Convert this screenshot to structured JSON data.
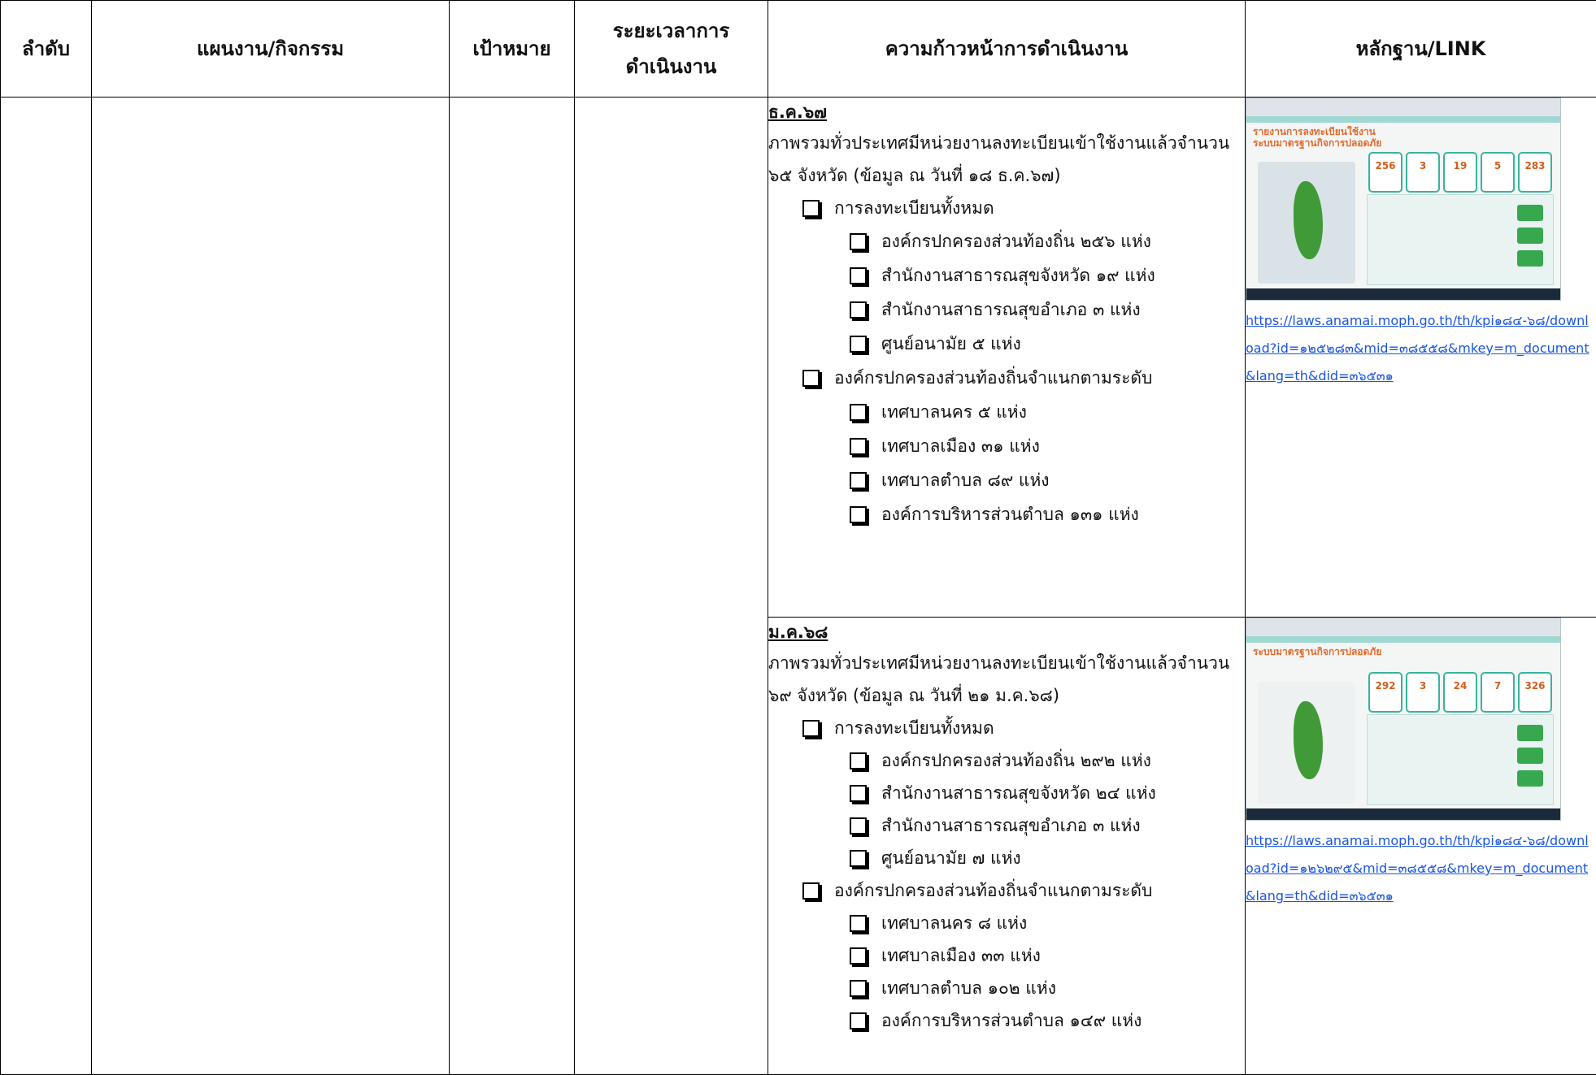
{
  "headers": {
    "order": "ลำดับ",
    "plan": "แผนงาน/กิจกรรม",
    "target": "เป้าหมาย",
    "period": "ระยะเวลาการ ดำเนินงาน",
    "progress": "ความก้าวหน้าการดำเนินงาน",
    "evidence": "หลักฐาน/LINK"
  },
  "rows": [
    {
      "month": "ธ.ค.๖๗",
      "summary": "ภาพรวมทั่วประเทศมีหน่วยงานลงทะเบียนเข้าใช้งานแล้วจำนวน ๖๕ จังหวัด (ข้อมูล ณ วันที่ ๑๘ ธ.ค.๖๗)",
      "group1_title": "การลงทะเบียนทั้งหมด",
      "group1_items": [
        "องค์กรปกครองส่วนท้องถิ่น ๒๕๖ แห่ง",
        "สำนักงานสาธารณสุขจังหวัด ๑๙ แห่ง",
        "สำนักงานสาธารณสุขอำเภอ ๓ แห่ง",
        "ศูนย์อนามัย  ๕ แห่ง"
      ],
      "group2_title": "องค์กรปกครองส่วนท้องถิ่นจำแนกตามระดับ",
      "group2_items": [
        "เทศบาลนคร ๕ แห่ง",
        "เทศบาลเมือง ๓๑ แห่ง",
        "เทศบาลตำบล ๘๙ แห่ง",
        "องค์การบริหารส่วนตำบล ๑๓๑ แห่ง"
      ],
      "screenshot": {
        "banner_line1": "รายงานการลงทะเบียนใช้งาน",
        "banner_line2": "ระบบมาตรฐานกิจการปลอดภัย",
        "tiles": [
          "256",
          "3",
          "19",
          "5",
          "283"
        ]
      },
      "link": "https://laws.anamai.moph.go.th/th/kpi๑๘๔-๖๘/download?id=๑๒๕๒๘๓&mid=๓๘๕๕๘&mkey=m_document&lang=th&did=๓๖๕๓๑"
    },
    {
      "month": "ม.ค.๖๘",
      "summary": "ภาพรวมทั่วประเทศมีหน่วยงานลงทะเบียนเข้าใช้งานแล้วจำนวน ๖๙ จังหวัด (ข้อมูล ณ วันที่ ๒๑ ม.ค.๖๘)",
      "group1_title": "การลงทะเบียนทั้งหมด",
      "group1_items": [
        "องค์กรปกครองส่วนท้องถิ่น ๒๙๒ แห่ง",
        "สำนักงานสาธารณสุขจังหวัด ๒๔ แห่ง",
        "สำนักงานสาธารณสุขอำเภอ ๓ แห่ง",
        "ศูนย์อนามัย  ๗ แห่ง"
      ],
      "group2_title": "องค์กรปกครองส่วนท้องถิ่นจำแนกตามระดับ",
      "group2_items": [
        "เทศบาลนคร ๘ แห่ง",
        "เทศบาลเมือง ๓๓ แห่ง",
        "เทศบาลตำบล ๑๐๒ แห่ง",
        "องค์การบริหารส่วนตำบล ๑๔๙ แห่ง"
      ],
      "screenshot": {
        "banner_line1": "",
        "banner_line2": "ระบบมาตรฐานกิจการปลอดภัย",
        "tiles": [
          "292",
          "3",
          "24",
          "7",
          "326"
        ]
      },
      "link": "https://laws.anamai.moph.go.th/th/kpi๑๘๔-๖๘/download?id=๑๒๖๒๙๕&mid=๓๘๕๕๘&mkey=m_document&lang=th&did=๓๖๕๓๑"
    }
  ],
  "colors": {
    "link": "#1a55e0",
    "accent_orange": "#e46a2a",
    "accent_teal": "#39b39b",
    "accent_green": "#38a84f"
  }
}
